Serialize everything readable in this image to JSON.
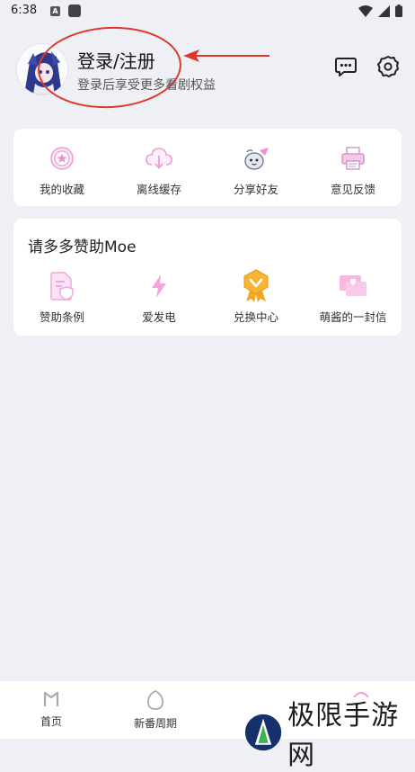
{
  "status_bar": {
    "time": "6:38",
    "notif_letter": "A"
  },
  "profile": {
    "title": "登录/注册",
    "subtitle": "登录后享受更多看剧权益"
  },
  "quick_actions": [
    {
      "label": "我的收藏",
      "icon": "favorites-icon"
    },
    {
      "label": "离线缓存",
      "icon": "offline-cache-icon"
    },
    {
      "label": "分享好友",
      "icon": "share-friends-icon"
    },
    {
      "label": "意见反馈",
      "icon": "feedback-icon"
    }
  ],
  "sponsor": {
    "title": "请多多赞助Moe",
    "items": [
      {
        "label": "赞助条例",
        "icon": "sponsor-terms-icon"
      },
      {
        "label": "爱发电",
        "icon": "lightning-icon"
      },
      {
        "label": "兑换中心",
        "icon": "redeem-badge-icon"
      },
      {
        "label": "萌酱的一封信",
        "icon": "letter-icon"
      }
    ]
  },
  "bottom_nav": [
    {
      "label": "首页"
    },
    {
      "label": "新番周期"
    }
  ],
  "watermark": {
    "text": "极限手游网"
  },
  "colors": {
    "accent": "#f29ad8",
    "annotation": "#e0372a",
    "gold": "#f5a623"
  }
}
